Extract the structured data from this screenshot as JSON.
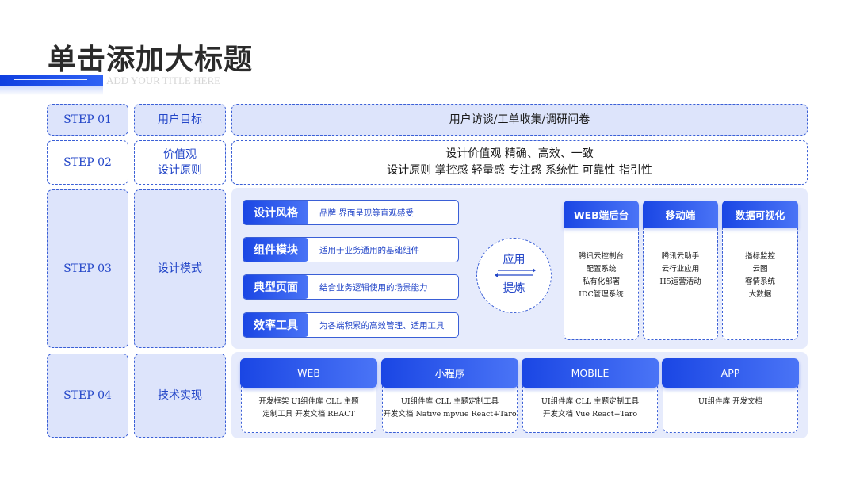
{
  "header": {
    "title": "单击添加大标题",
    "subtitle": "ADD YOUR TITLE HERE"
  },
  "steps": {
    "s1": {
      "label": "STEP 01",
      "category": "用户目标",
      "content": "用户访谈/工单收集/调研问卷"
    },
    "s2": {
      "label": "STEP 02",
      "category_line1": "价值观",
      "category_line2": "设计原则",
      "content_line1": "设计价值观  精确、高效、一致",
      "content_line2": "设计原则  掌控感 轻量感 专注感 系统性 可靠性 指引性"
    },
    "s3": {
      "label": "STEP 03",
      "category": "设计模式"
    },
    "s4": {
      "label": "STEP 04",
      "category": "技术实现"
    }
  },
  "patterns": [
    {
      "label": "设计风格",
      "desc": "品牌 界面呈现等直观感受"
    },
    {
      "label": "组件模块",
      "desc": "适用于业务通用的基础组件"
    },
    {
      "label": "典型页面",
      "desc": "结合业务逻辑使用的场景能力"
    },
    {
      "label": "效率工具",
      "desc": "为各端积累的高效管理、适用工具"
    }
  ],
  "cycle": {
    "top": "应用",
    "bottom": "提炼"
  },
  "platforms": [
    {
      "title": "WEB端后台",
      "items": [
        "腾讯云控制台",
        "配置系统",
        "私有化部署",
        "IDC管理系统"
      ]
    },
    {
      "title": "移动端",
      "items": [
        "腾讯云助手",
        "云行业应用",
        "H5运营活动"
      ]
    },
    {
      "title": "数据可视化",
      "items": [
        "指标监控",
        "云图",
        "客情系统",
        "大数据"
      ]
    }
  ],
  "tech": [
    {
      "title": "WEB",
      "lines": [
        "开发框架 UI组件库  CLL 主题",
        "定制工具 开发文档 REACT"
      ]
    },
    {
      "title": "小程序",
      "lines": [
        "UI组件库  CLL 主题定制工具",
        "开发文档 Native mpvue React+Taro"
      ]
    },
    {
      "title": "MOBILE",
      "lines": [
        "UI组件库  CLL 主题定制工具",
        "开发文档  Vue React+Taro"
      ]
    },
    {
      "title": "APP",
      "lines": [
        "UI组件库  开发文档"
      ]
    }
  ],
  "colors": {
    "accent": "#1a46e4",
    "border": "#3a5fd6",
    "fill": "#dde4fb",
    "panel": "#e6ebfc"
  }
}
